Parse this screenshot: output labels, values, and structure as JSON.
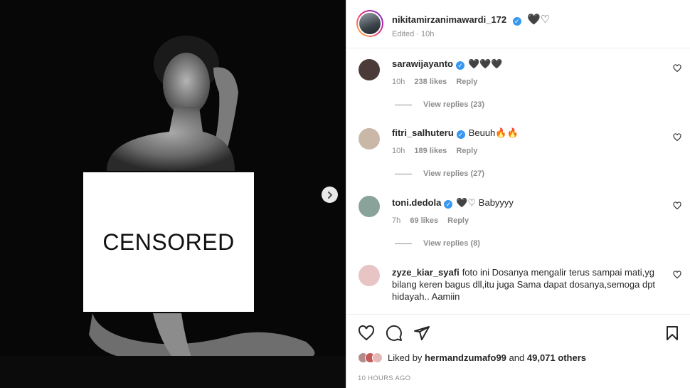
{
  "media": {
    "censor_label": "CENSORED"
  },
  "post": {
    "author": "nikitamirzanimawardi_172",
    "caption_hearts": "🖤♡",
    "edited_label": "Edited · 10h"
  },
  "comments": [
    {
      "username": "sarawijayanto",
      "text": "🖤🖤🖤",
      "time": "10h",
      "likes": "238 likes",
      "reply": "Reply",
      "view_replies": "View replies (23)",
      "avatar_color": "#4a3a38"
    },
    {
      "username": "fitri_salhuteru",
      "text": "Beuuh🔥🔥",
      "time": "10h",
      "likes": "189 likes",
      "reply": "Reply",
      "view_replies": "View replies (27)",
      "avatar_color": "#c9b8a8"
    },
    {
      "username": "toni.dedola",
      "text": "🖤♡ Babyyyy",
      "time": "7h",
      "likes": "69 likes",
      "reply": "Reply",
      "view_replies": "View replies (8)",
      "avatar_color": "#8aa39a"
    },
    {
      "username": "zyze_kiar_syafi",
      "text": "foto ini Dosanya mengalir terus sampai mati,yg bilang keren bagus dll,itu juga Sama dapat dosanya,semoga dpt hidayah.. Aamiin",
      "avatar_color": "#e8c4c4"
    }
  ],
  "footer": {
    "liked_by_prefix": "Liked by",
    "liked_by_user": "hermandzumafo99",
    "liked_by_and": "and",
    "liked_by_others": "49,071 others",
    "timestamp": "10 HOURS AGO"
  },
  "colors": {
    "verified": "#3897f0",
    "muted": "#8e8e8e",
    "text": "#262626"
  }
}
